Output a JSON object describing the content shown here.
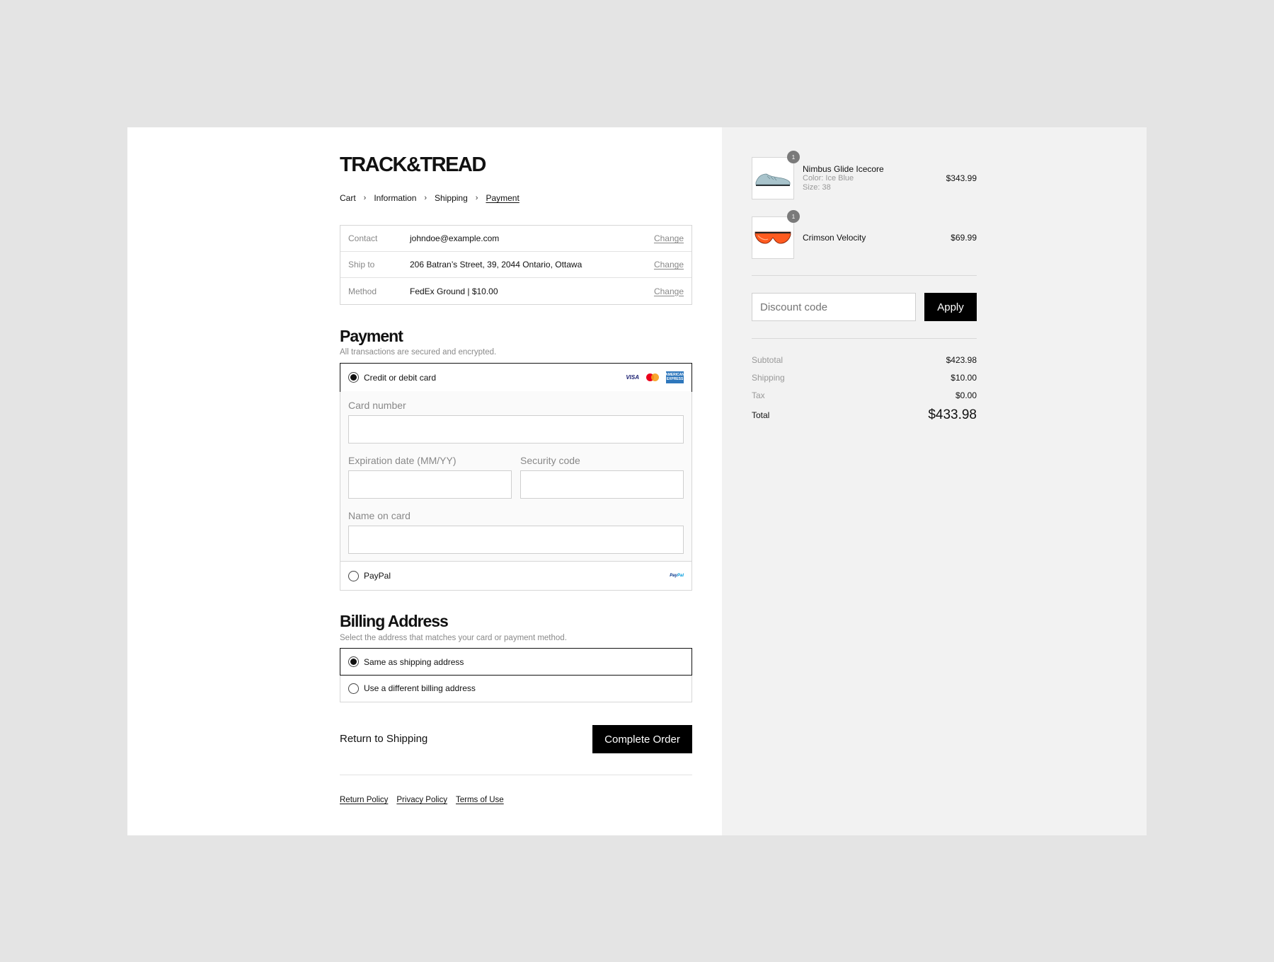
{
  "brand": {
    "logo": "TRACK&TREAD"
  },
  "breadcrumb": [
    {
      "label": "Cart"
    },
    {
      "label": "Information"
    },
    {
      "label": "Shipping"
    },
    {
      "label": "Payment"
    }
  ],
  "breadcrumb_separator": "›",
  "summary": {
    "rows": [
      {
        "key": "Contact",
        "value": "johndoe@example.com",
        "action": "Change"
      },
      {
        "key": "Ship to",
        "value": "206 Batran’s Street, 39, 2044 Ontario, Ottawa",
        "action": "Change"
      },
      {
        "key": "Method",
        "value": "FedEx Ground | $10.00",
        "action": "Change"
      }
    ]
  },
  "payment": {
    "title": "Payment",
    "subtitle": "All transactions are secured and encrypted.",
    "card_option": "Credit or debit card",
    "card_brands": {
      "visa": "VISA",
      "amex": "AMERICAN EXPRESS"
    },
    "card_number_label": "Card number",
    "expiry_label": "Expiration date (MM/YY)",
    "security_label": "Security code",
    "name_label": "Name on card",
    "paypal_option": "PayPal",
    "paypal_logo_a": "Pay",
    "paypal_logo_b": "Pal"
  },
  "billing": {
    "title": "Billing Address",
    "subtitle": "Select the address that matches your card or payment method.",
    "same_option": "Same as shipping address",
    "different_option": "Use a different billing address"
  },
  "actions": {
    "return_label": "Return to Shipping",
    "complete_label": "Complete Order"
  },
  "footer": {
    "links": [
      "Return Policy",
      "Privacy Policy",
      "Terms of Use"
    ]
  },
  "cart": {
    "items": [
      {
        "qty": "1",
        "name": "Nimbus Glide Icecore",
        "color": "Color: Ice Blue",
        "size": "Size: 38",
        "price": "$343.99"
      },
      {
        "qty": "1",
        "name": "Crimson Velocity",
        "price": "$69.99"
      }
    ],
    "discount_placeholder": "Discount code",
    "apply_label": "Apply",
    "totals": {
      "subtotal_label": "Subtotal",
      "subtotal": "$423.98",
      "shipping_label": "Shipping",
      "shipping": "$10.00",
      "tax_label": "Tax",
      "tax": "$0.00",
      "total_label": "Total",
      "total": "$433.98"
    }
  },
  "colors": {
    "accent": "#000000",
    "panel": "#f2f2f2",
    "backdrop": "#e4e4e4",
    "shoe": "#a9c4cc",
    "lens": "#ff5a1f"
  }
}
